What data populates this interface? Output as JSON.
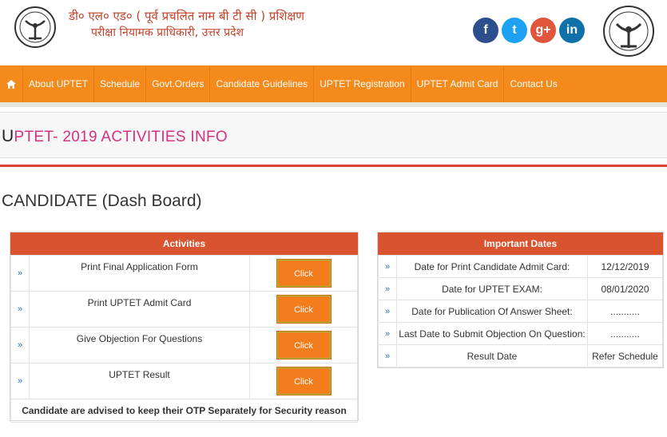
{
  "header": {
    "line1": "डी० एल० एड० ( पूर्व प्रचलित नाम बी टी सी ) प्रशिक्षण",
    "line2": "परीक्षा नियामक प्राधिकारी, उत्तर प्रदेश",
    "social": [
      {
        "name": "facebook-icon",
        "glyph": "f"
      },
      {
        "name": "twitter-icon",
        "glyph": "t"
      },
      {
        "name": "google-plus-icon",
        "glyph": "g+"
      },
      {
        "name": "linkedin-icon",
        "glyph": "in"
      }
    ]
  },
  "nav": {
    "home_icon": "home-icon",
    "items": [
      "About UPTET",
      "Schedule",
      "Govt.Orders",
      "Candidate Guidelines",
      "UPTET Registration",
      "UPTET Admit Card",
      "Contact Us"
    ]
  },
  "page": {
    "title_first": "U",
    "title_rest": "PTET- 2019 ACTIVITIES INFO",
    "dashboard_title": "CANDIDATE (Dash Board)"
  },
  "activities": {
    "header": "Activities",
    "rows": [
      {
        "label": "Print Final Application Form",
        "button": "Click"
      },
      {
        "label": "Print UPTET Admit Card",
        "button": "Click"
      },
      {
        "label": "Give Objection For Questions",
        "button": "Click"
      },
      {
        "label": "UPTET Result",
        "button": "Click"
      }
    ],
    "note": "Candidate are advised to keep their OTP Separately for Security reason"
  },
  "dates": {
    "header": "Important Dates",
    "rows": [
      {
        "label": "Date for Print Candidate Admit Card:",
        "value": "12/12/2019"
      },
      {
        "label": "Date for UPTET EXAM:",
        "value": "08/01/2020"
      },
      {
        "label": "Date for Publication Of Answer Sheet:",
        "value": "..........."
      },
      {
        "label": "Last Date to Submit Objection On Question:",
        "value": "..........."
      },
      {
        "label": "Result Date",
        "value": "Refer Schedule"
      }
    ]
  },
  "colors": {
    "nav_bg": "#f38a1b",
    "panel_head": "#d9532f",
    "title_pink": "#d6317e",
    "button": "#f37d1d"
  },
  "arrow_glyph": "»"
}
